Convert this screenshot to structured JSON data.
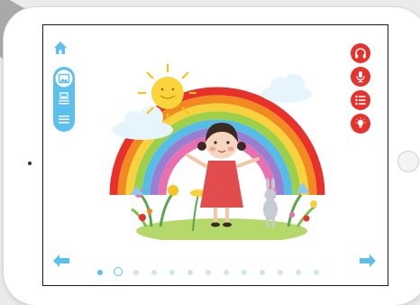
{
  "colors": {
    "accent_blue": "#5cc0ee",
    "accent_red": "#e8312a",
    "rainbow": [
      "#e8312a",
      "#f28a22",
      "#f7d23c",
      "#9ccf4a",
      "#57bde8",
      "#9a7fd1",
      "#e96fb0"
    ]
  },
  "toolbar_left": {
    "home_icon": "home-icon",
    "items": [
      "image-icon",
      "image-text-icon",
      "text-icon"
    ]
  },
  "toolbar_right": {
    "items": [
      "headphones-icon",
      "microphone-icon",
      "list-icon",
      "lightbulb-icon"
    ]
  },
  "navigation": {
    "prev_icon": "arrow-left-icon",
    "next_icon": "arrow-right-icon"
  },
  "pagination": {
    "total": 13,
    "current": 2
  },
  "illustration": {
    "subject": "girl-rainbow-sun-rabbit-flowers"
  }
}
